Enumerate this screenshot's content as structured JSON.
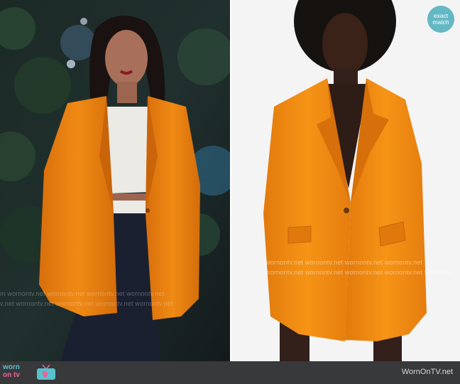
{
  "left_panel": {
    "watermarks": [
      "m wornontv.net wornontv.net wornontv.net wornontv.net",
      "v.net wornontv.net wornontv.net wornontv.net wornontv.net"
    ]
  },
  "right_panel": {
    "badge": {
      "line1": "exact",
      "line2": "match",
      "color": "#63b8c4"
    },
    "watermarks": [
      "wornontv.net wornontv.net wornontv.net wornontv.net",
      "wornontv.net wornontv.net wornontv.net wornontv.net wornontv"
    ]
  },
  "footer": {
    "logo": {
      "word1": "worn",
      "word2": "on tv",
      "icon": "tv-icon"
    },
    "site": "WornOnTV.net",
    "background": "#38393b"
  },
  "colors": {
    "blazer": "#f28a12",
    "logo_teal": "#59c0cd",
    "logo_pink": "#e5669a"
  }
}
